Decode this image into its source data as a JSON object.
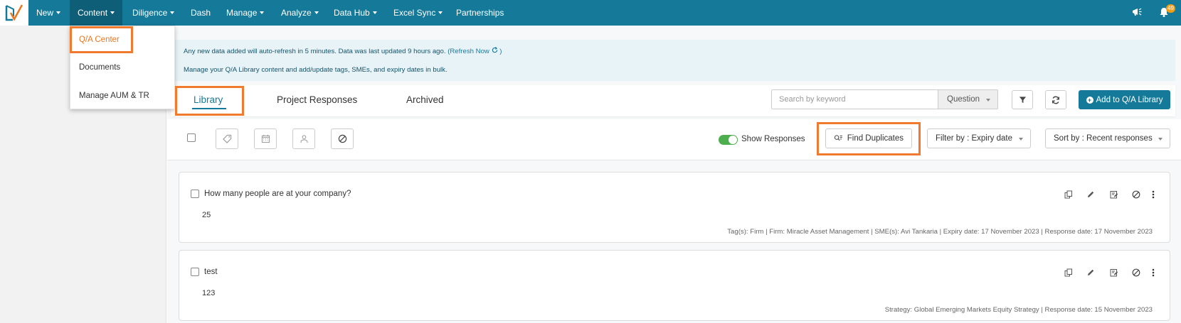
{
  "nav": {
    "items": [
      {
        "label": "New"
      },
      {
        "label": "Content"
      },
      {
        "label": "Diligence"
      },
      {
        "label": "Dash"
      },
      {
        "label": "Manage"
      },
      {
        "label": "Analyze"
      },
      {
        "label": "Data Hub"
      },
      {
        "label": "Excel Sync"
      },
      {
        "label": "Partnerships"
      }
    ],
    "notification_count": "49"
  },
  "content_menu": {
    "items": [
      {
        "label": "Q/A Center"
      },
      {
        "label": "Documents"
      },
      {
        "label": "Manage AUM & TR"
      }
    ]
  },
  "banner": {
    "refresh_text": "Any new data added will auto-refresh in 5 minutes. Data was last updated 9 hours ago.",
    "refresh_link": "(Refresh Now",
    "refresh_link_close": ")",
    "manage_text": "Manage your Q/A Library content and add/update tags, SMEs, and expiry dates in bulk."
  },
  "tabs": [
    {
      "label": "Library"
    },
    {
      "label": "Project Responses"
    },
    {
      "label": "Archived"
    }
  ],
  "search": {
    "placeholder": "Search by keyword",
    "type_selected": "Question"
  },
  "add_button": "Add to Q/A Library",
  "toolbar": {
    "show_responses_label": "Show Responses",
    "find_duplicates_label": "Find Duplicates",
    "filter_label": "Filter by : Expiry date",
    "sort_label": "Sort by : Recent responses"
  },
  "cards": [
    {
      "question": "How many people are at your company?",
      "answer": "25",
      "meta": "Tag(s):  Firm  |  Firm: Miracle Asset Management  |  SME(s):  Avi Tankaria  |  Expiry date: 17 November 2023  |  Response date: 17 November 2023"
    },
    {
      "question": "test",
      "answer": "123",
      "meta": "Strategy: Global Emerging Markets Equity Strategy  |  Response date: 15 November 2023"
    }
  ],
  "colors": {
    "brand": "#157a9a",
    "highlight": "#f07b2e",
    "toggle_on": "#4cae4c"
  }
}
